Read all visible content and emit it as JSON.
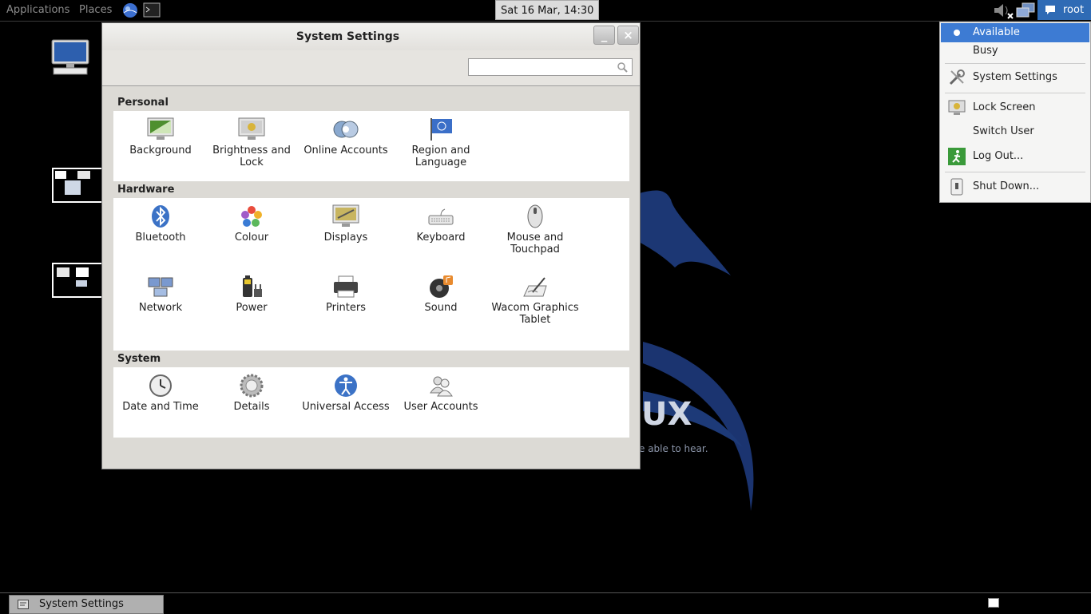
{
  "top_panel": {
    "applications_label": "Applications",
    "places_label": "Places",
    "clock": "Sat 16 Mar, 14:30",
    "user": "root"
  },
  "wallpaper": {
    "brand_fragment": "UX",
    "tagline_fragment": "e able to hear."
  },
  "window": {
    "title": "System Settings",
    "minimize_label": "_",
    "close_label": "×",
    "search_placeholder": "",
    "sections": [
      {
        "title": "Personal",
        "items": [
          {
            "label": "Background",
            "icon": "background-icon"
          },
          {
            "label": "Brightness and Lock",
            "icon": "brightness-lock-icon"
          },
          {
            "label": "Online Accounts",
            "icon": "online-accounts-icon"
          },
          {
            "label": "Region and Language",
            "icon": "region-flag-icon"
          }
        ]
      },
      {
        "title": "Hardware",
        "items": [
          {
            "label": "Bluetooth",
            "icon": "bluetooth-icon"
          },
          {
            "label": "Colour",
            "icon": "colour-icon"
          },
          {
            "label": "Displays",
            "icon": "displays-icon"
          },
          {
            "label": "Keyboard",
            "icon": "keyboard-icon"
          },
          {
            "label": "Mouse and Touchpad",
            "icon": "mouse-icon"
          },
          {
            "label": "Network",
            "icon": "network-icon"
          },
          {
            "label": "Power",
            "icon": "power-icon"
          },
          {
            "label": "Printers",
            "icon": "printer-icon"
          },
          {
            "label": "Sound",
            "icon": "sound-icon"
          },
          {
            "label": "Wacom Graphics Tablet",
            "icon": "wacom-tablet-icon"
          }
        ]
      },
      {
        "title": "System",
        "items": [
          {
            "label": "Date and Time",
            "icon": "clock-icon"
          },
          {
            "label": "Details",
            "icon": "gear-icon"
          },
          {
            "label": "Universal Access",
            "icon": "accessibility-icon"
          },
          {
            "label": "User Accounts",
            "icon": "users-icon"
          }
        ]
      }
    ]
  },
  "user_menu": {
    "items": [
      "Available",
      "Busy",
      "System Settings",
      "Lock Screen",
      "Switch User",
      "Log Out...",
      "Shut Down..."
    ],
    "selected": "Available",
    "highlight_color": "#3d7bd3"
  },
  "taskbar": {
    "task_label": "System Settings"
  }
}
